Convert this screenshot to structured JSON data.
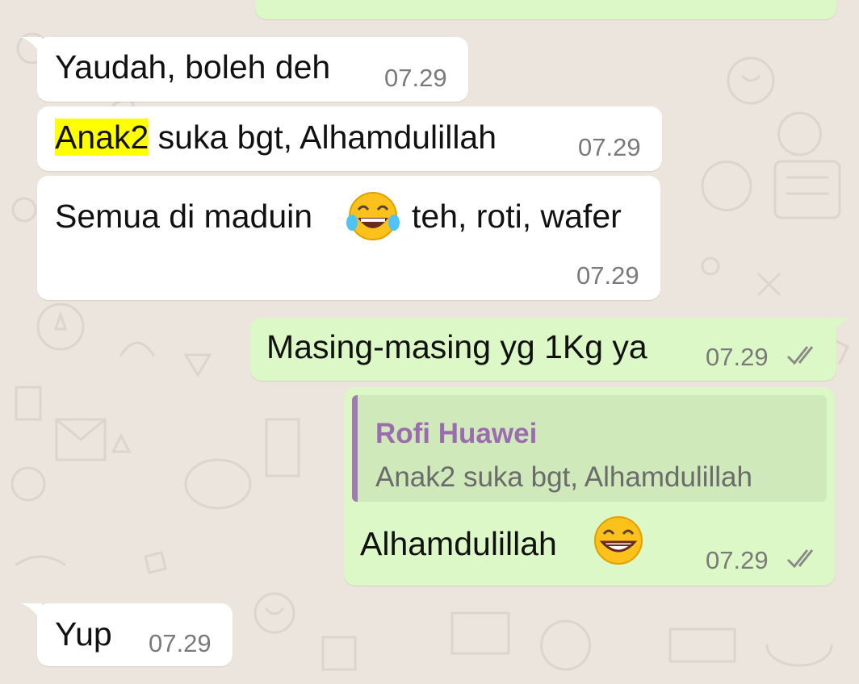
{
  "chat": {
    "messages": [
      {
        "direction": "incoming",
        "time": "07.29",
        "text_after": ", boleh deh",
        "text_before": "Yaudah"
      },
      {
        "direction": "incoming",
        "time": "07.29",
        "highlight": "Anak2",
        "text": " suka bgt, Alhamdulillah"
      },
      {
        "direction": "incoming",
        "time": "07.29",
        "text_before": "Semua di maduin",
        "emoji": "face-with-tears-of-joy",
        "text_after": "teh, roti, wafer"
      },
      {
        "direction": "outgoing",
        "time": "07.29",
        "text": "Masing-masing yg 1Kg ya",
        "status": "read"
      },
      {
        "direction": "outgoing",
        "time": "07.29",
        "quote": {
          "author": "Rofi Huawei",
          "text": "Anak2 suka bgt, Alhamdulillah"
        },
        "text": "Alhamdulillah",
        "emoji": "grinning-face",
        "status": "read"
      },
      {
        "direction": "incoming",
        "time": "07.29",
        "text": "Yup"
      }
    ]
  },
  "colors": {
    "background": "#ece5dd",
    "incoming_bubble": "#ffffff",
    "outgoing_bubble": "#dcf8c6",
    "quote_bar": "#a07bb0",
    "quote_author": "#9b6cb0",
    "highlight": "#ffff00",
    "read_ticks": "#8a8a8a"
  }
}
